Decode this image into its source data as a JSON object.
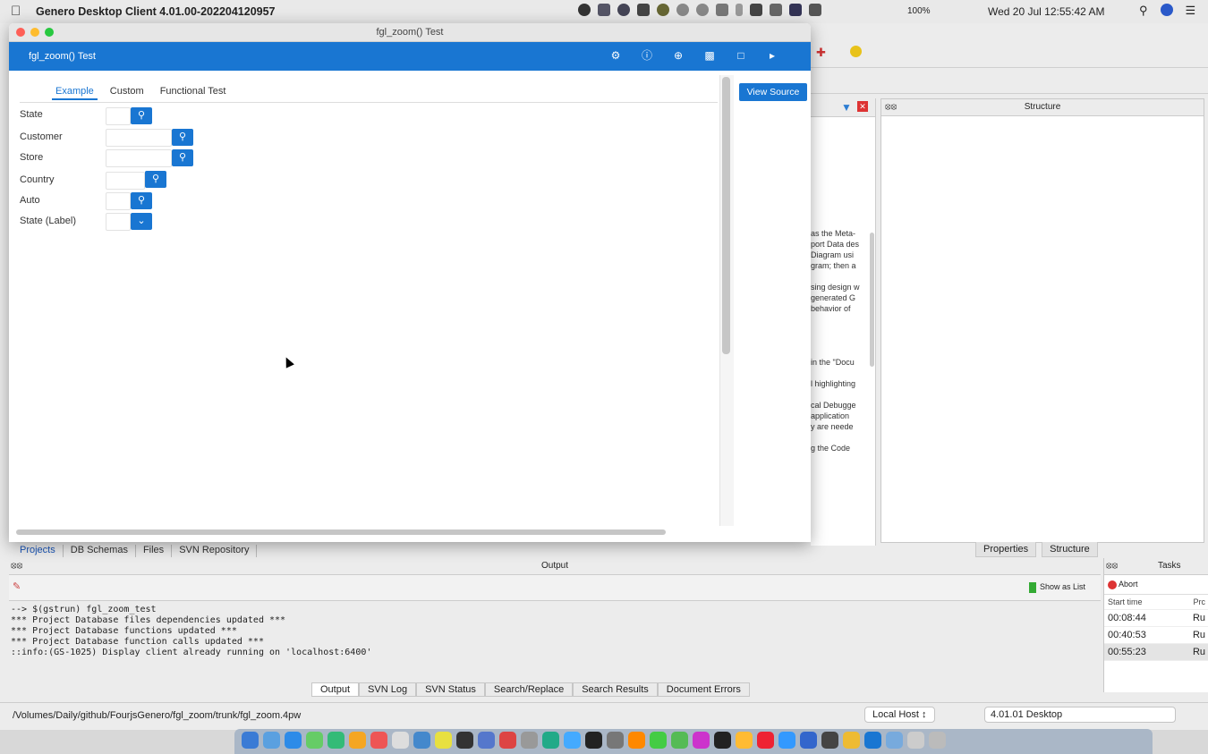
{
  "menubar": {
    "app_name": "Genero Desktop Client 4.01.00-202204120957",
    "battery": "100%",
    "clock": "Wed 20 Jul  12:55:42 AM"
  },
  "window": {
    "title": "fgl_zoom() Test",
    "header_title": "fgl_zoom() Test",
    "tabs": [
      "Example",
      "Custom",
      "Functional Test"
    ],
    "view_source_label": "View Source",
    "fields": [
      {
        "label": "State"
      },
      {
        "label": "Customer"
      },
      {
        "label": "Store"
      },
      {
        "label": "Country"
      },
      {
        "label": "Auto"
      },
      {
        "label": "State (Label)"
      }
    ]
  },
  "ide": {
    "structure_title": "Structure",
    "struct_tabs": [
      "Properties",
      "Structure"
    ],
    "project_tabs": [
      "Projects",
      "DB Schemas",
      "Files",
      "SVN Repository"
    ],
    "doc_fragments": [
      "as the Meta-",
      "port Data des",
      "",
      "Diagram usi",
      "gram; then a",
      "",
      "sing design w",
      "generated G",
      "behavior of",
      "",
      "",
      "",
      "in the \"Docu",
      "",
      "l highlighting",
      "",
      "cal Debugge",
      "application",
      "y are neede",
      "",
      "g the Code"
    ],
    "output_title": "Output",
    "show_as_list": "Show as List",
    "output_lines": [
      "--> $(gstrun) fgl_zoom_test",
      "*** Project Database files dependencies updated ***",
      "*** Project Database functions updated ***",
      "*** Project Database function calls updated ***",
      "::info:(GS-1025) Display client already running on 'localhost:6400'"
    ],
    "output_tabs": [
      "Output",
      "SVN Log",
      "SVN Status",
      "Search/Replace",
      "Search Results",
      "Document Errors"
    ],
    "tasks": {
      "title": "Tasks",
      "abort": "Abort",
      "col1": "Start time",
      "col2": "Prc",
      "rows": [
        {
          "time": "00:08:44",
          "status": "Ru"
        },
        {
          "time": "00:40:53",
          "status": "Ru"
        },
        {
          "time": "00:55:23",
          "status": "Ru"
        }
      ]
    },
    "status_path": "/Volumes/Daily/github/FourjsGenero/fgl_zoom/trunk/fgl_zoom.4pw",
    "host": "Local Host",
    "version": "4.01.01 Desktop"
  },
  "colors": {
    "accent": "#1976d2"
  }
}
